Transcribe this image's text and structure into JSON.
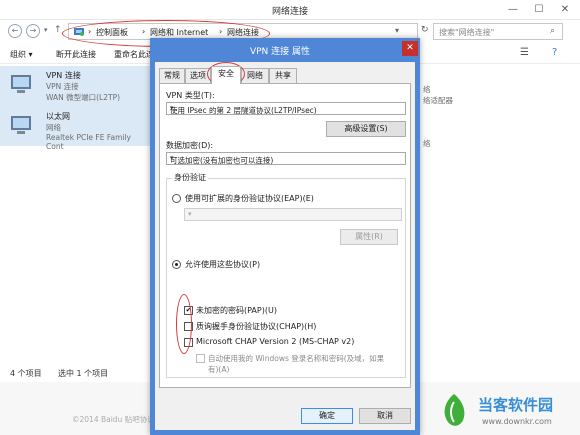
{
  "window": {
    "title": "网络连接",
    "minimize": "—",
    "maximize": "☐",
    "close": "✕"
  },
  "address": {
    "icon": "network-folder",
    "crumbs": [
      "控制面板",
      "网络和 Internet",
      "网络连接"
    ],
    "sep": "›",
    "search_placeholder": "搜索\"网络连接\""
  },
  "toolbar": {
    "organize": "组织 ▾",
    "disconnect": "断开此连接",
    "rename": "重命名此连接"
  },
  "connections": [
    {
      "name": "VPN 连接",
      "line2": "VPN 连接",
      "line3": "WAN 微型端口(L2TP)"
    },
    {
      "name": "以太网",
      "line2": "网络",
      "line3": "Realtek PCIe FE Family Cont"
    }
  ],
  "right_fragments": {
    "a": "络",
    "b": "络适配器",
    "c": "络"
  },
  "status": {
    "count": "4 个项目",
    "selected": "选中 1 个项目"
  },
  "footer_copy": "©2014 Baidu 贴吧协议",
  "dialog": {
    "title": "VPN 连接 属性",
    "tabs": [
      "常规",
      "选项",
      "安全",
      "网络",
      "共享"
    ],
    "active_tab": "安全",
    "vpn_type_label": "VPN 类型(T):",
    "vpn_type_value": "使用 IPsec 的第 2 层隧道协议(L2TP/IPsec)",
    "advanced_button": "高级设置(S)",
    "encryption_label": "数据加密(D):",
    "encryption_value": "可选加密(没有加密也可以连接)",
    "auth_group_label": "身份验证",
    "eap_option": "使用可扩展的身份验证协议(EAP)(E)",
    "properties_button": "属性(R)",
    "allow_option": "允许使用这些协议(P)",
    "pap": "未加密的密码(PAP)(U)",
    "chap": "质询握手身份验证协议(CHAP)(H)",
    "mschap": "Microsoft CHAP Version 2 (MS-CHAP v2)",
    "auto_logon_1": "自动使用我的 Windows 登录名称和密码(及域，如果",
    "auto_logon_2": "有)(A)",
    "ok": "确定",
    "cancel": "取消"
  },
  "watermark": {
    "name": "当客软件园",
    "url": "www.downkr.com"
  },
  "colors": {
    "dialog_frame": "#4f86d6",
    "close_red": "#c7302a",
    "annotation_red": "#d43a3a",
    "watermark_green": "#3fae3a"
  }
}
